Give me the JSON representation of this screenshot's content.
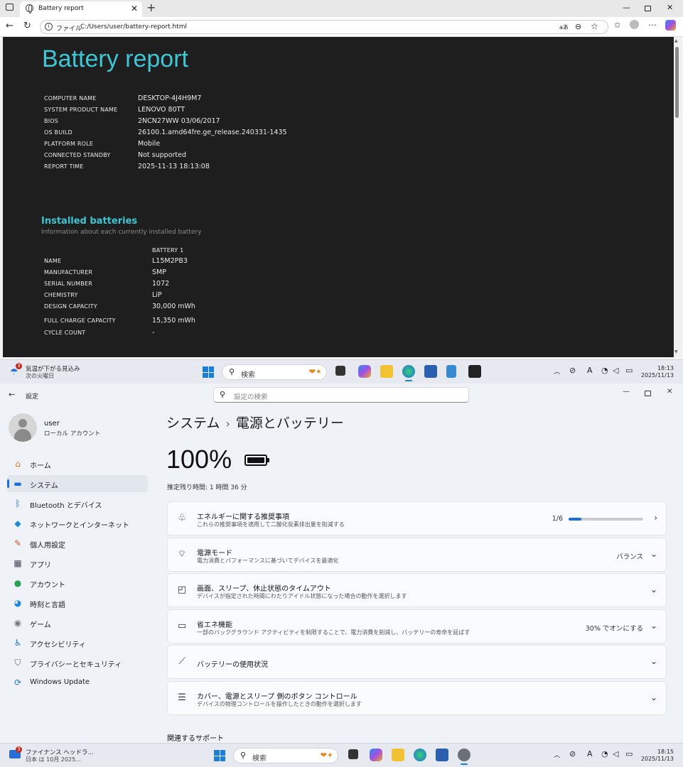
{
  "browser": {
    "tab_title": "Battery report",
    "address_label": "ファイル",
    "url": "C:/Users/user/battery-report.html",
    "toolbar_text": "aあ"
  },
  "report": {
    "title": "Battery report",
    "system_info": [
      {
        "label": "COMPUTER NAME",
        "value": "DESKTOP-4J4H9M7"
      },
      {
        "label": "SYSTEM PRODUCT NAME",
        "value": "LENOVO 80TT"
      },
      {
        "label": "BIOS",
        "value": "2NCN27WW 03/06/2017"
      },
      {
        "label": "OS BUILD",
        "value": "26100.1.amd64fre.ge_release.240331-1435"
      },
      {
        "label": "PLATFORM ROLE",
        "value": "Mobile"
      },
      {
        "label": "CONNECTED STANDBY",
        "value": "Not supported"
      },
      {
        "label": "REPORT TIME",
        "value": "2025-11-13  18:13:08"
      }
    ],
    "installed_heading": "Installed batteries",
    "installed_sub": "Information about each currently installed battery",
    "battery_col": "BATTERY 1",
    "battery_info": [
      {
        "label": "NAME",
        "value": "L15M2PB3"
      },
      {
        "label": "MANUFACTURER",
        "value": "SMP"
      },
      {
        "label": "SERIAL NUMBER",
        "value": "1072"
      },
      {
        "label": "CHEMISTRY",
        "value": "LiP"
      },
      {
        "label": "DESIGN CAPACITY",
        "value": "30,000 mWh"
      },
      {
        "label": "FULL CHARGE CAPACITY",
        "value": "15,350 mWh"
      },
      {
        "label": "CYCLE COUNT",
        "value": "-"
      }
    ]
  },
  "taskbar1": {
    "widget_line1": "気温が下がる見込み",
    "widget_line2": "次の火曜日",
    "badge": "3",
    "search": "検索",
    "time": "18:13",
    "date": "2025/11/13",
    "ime": "A"
  },
  "taskbar2": {
    "widget_line1": "ファイナンス ヘッドラ...",
    "widget_line2": "日本 は 10月 2025...",
    "badge": "3",
    "search": "検索",
    "time": "18:15",
    "date": "2025/11/13",
    "ime": "A"
  },
  "settings": {
    "app_title": "設定",
    "search_placeholder": "設定の検索",
    "user_name": "user",
    "user_sub": "ローカル アカウント",
    "nav": [
      {
        "label": "ホーム",
        "icon": "home-icon",
        "glyph": "⌂",
        "color": "#d2762a"
      },
      {
        "label": "システム",
        "icon": "monitor-icon",
        "glyph": "▬",
        "color": "#1c6fd6"
      },
      {
        "label": "Bluetooth とデバイス",
        "icon": "bluetooth-icon",
        "glyph": "ᛒ",
        "color": "#1c6fd6"
      },
      {
        "label": "ネットワークとインターネット",
        "icon": "wifi-icon",
        "glyph": "◆",
        "color": "#1c8ad6"
      },
      {
        "label": "個人用設定",
        "icon": "brush-icon",
        "glyph": "✎",
        "color": "#c8562a"
      },
      {
        "label": "アプリ",
        "icon": "apps-icon",
        "glyph": "▦",
        "color": "#445"
      },
      {
        "label": "アカウント",
        "icon": "person-icon",
        "glyph": "●",
        "color": "#2aa05a"
      },
      {
        "label": "時刻と言語",
        "icon": "globe-clock-icon",
        "glyph": "◕",
        "color": "#1c8ad6"
      },
      {
        "label": "ゲーム",
        "icon": "gamepad-icon",
        "glyph": "◉",
        "color": "#777"
      },
      {
        "label": "アクセシビリティ",
        "icon": "accessibility-icon",
        "glyph": "♿",
        "color": "#1c6fd6"
      },
      {
        "label": "プライバシーとセキュリティ",
        "icon": "shield-icon",
        "glyph": "⛉",
        "color": "#666"
      },
      {
        "label": "Windows Update",
        "icon": "update-icon",
        "glyph": "⟳",
        "color": "#1c6fd6"
      }
    ],
    "breadcrumb_parent": "システム",
    "breadcrumb_sep": "›",
    "breadcrumb_current": "電源とバッテリー",
    "battery_percent": "100%",
    "battery_level": 1.0,
    "remaining": "推定残り時間: 1 時間 36 分",
    "cards": [
      {
        "title": "エネルギーに関する推奨事項",
        "sub": "これらの推奨事項を適用して二酸化炭素排出量を削減する",
        "icon": "leaf-icon",
        "glyph": "♧",
        "right": "1/6",
        "progress": 0.17,
        "chevron": "›"
      },
      {
        "title": "電源モード",
        "sub": "電力消費とパフォーマンスに基づいてデバイスを最適化",
        "icon": "power-mode-icon",
        "glyph": "⌔",
        "right": "バランス",
        "chevron": "⌄"
      },
      {
        "title": "画面、スリープ、休止状態のタイムアウト",
        "sub": "デバイスが指定された時間にわたりアイドル状態になった場合の動作を選択します",
        "icon": "screen-sleep-icon",
        "glyph": "◰",
        "right": "",
        "chevron": "⌄"
      },
      {
        "title": "省エネ機能",
        "sub": "一部のバックグラウンド アクティビティを制限することで、電力消費を削減し、バッテリーの寿命を延ばす",
        "icon": "battery-saver-icon",
        "glyph": "▭",
        "right": "30% でオンにする",
        "chevron": "⌄"
      },
      {
        "title": "バッテリーの使用状況",
        "sub": "",
        "icon": "chart-icon",
        "glyph": "⟋",
        "right": "",
        "chevron": "⌄"
      },
      {
        "title": "カバー、電源とスリープ 側のボタン コントロール",
        "sub": "デバイスの物理コントロールを操作したときの動作を選択します",
        "icon": "button-controls-icon",
        "glyph": "☰",
        "right": "",
        "chevron": "⌄"
      }
    ],
    "related": "関連するサポート"
  }
}
